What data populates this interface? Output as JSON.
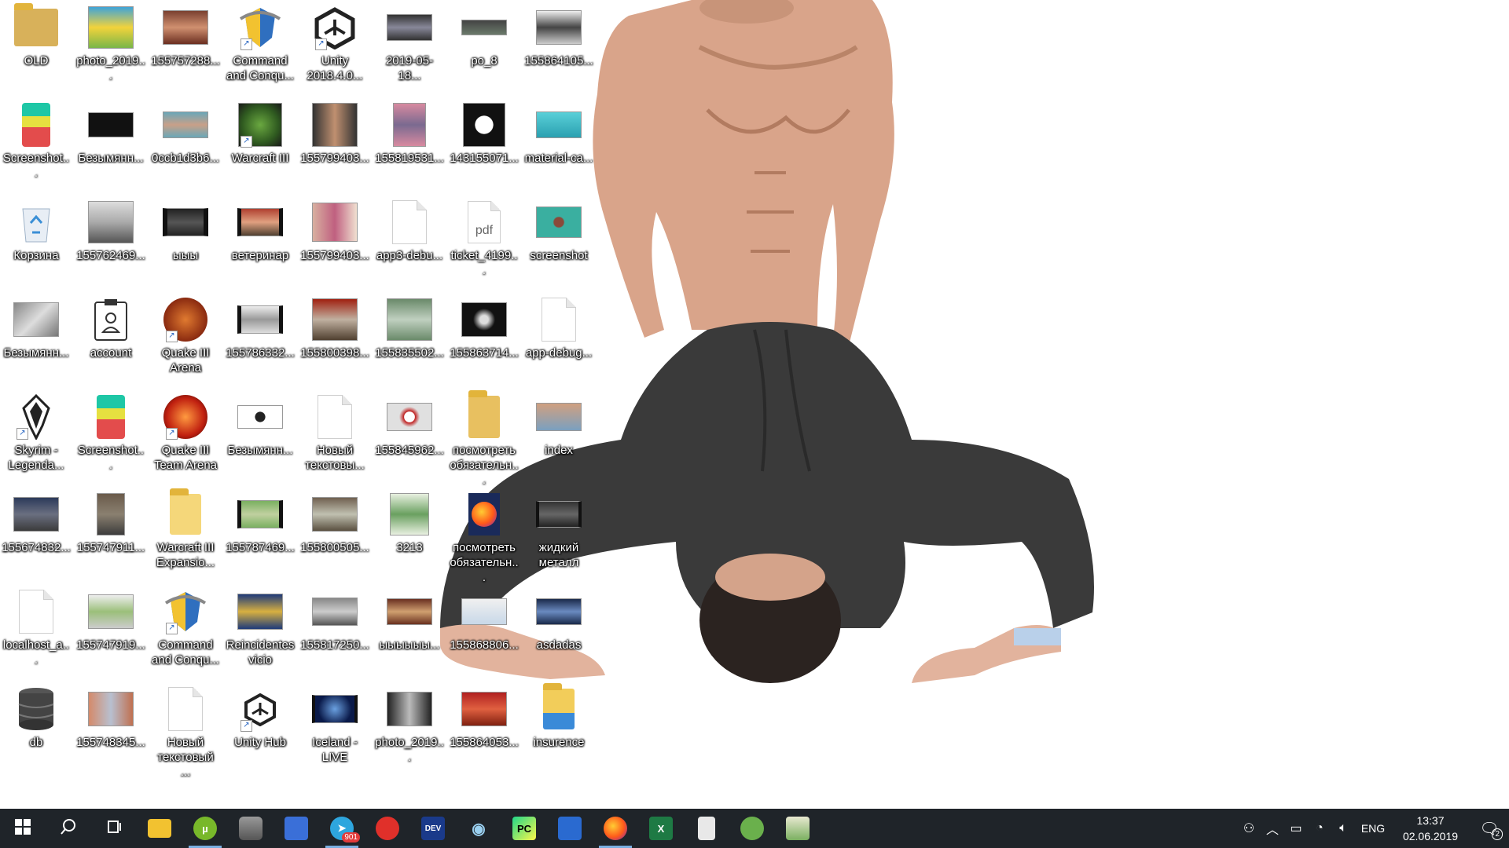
{
  "desktop": {
    "icons": [
      {
        "id": "c0r0",
        "label": "OLD"
      },
      {
        "id": "c1r0",
        "label": "photo_2019..."
      },
      {
        "id": "c2r0",
        "label": "155757288..."
      },
      {
        "id": "c3r0",
        "label": "Command and Conqu..."
      },
      {
        "id": "c4r0",
        "label": "Unity 2018.4.0..."
      },
      {
        "id": "c5r0",
        "label": "2019-05-18..."
      },
      {
        "id": "c6r0",
        "label": "po_8"
      },
      {
        "id": "c7r0",
        "label": "155864105..."
      },
      {
        "id": "c0r1",
        "label": "Screenshot..."
      },
      {
        "id": "c1r1",
        "label": "Безымянн..."
      },
      {
        "id": "c2r1",
        "label": "0ccb1d3b6..."
      },
      {
        "id": "c3r1",
        "label": "Warcraft III"
      },
      {
        "id": "c4r1",
        "label": "155799403..."
      },
      {
        "id": "c5r1",
        "label": "155819531..."
      },
      {
        "id": "c6r1",
        "label": "143155071..."
      },
      {
        "id": "c7r1",
        "label": "material-ca..."
      },
      {
        "id": "c0r2",
        "label": "Корзина"
      },
      {
        "id": "c1r2",
        "label": "155762469..."
      },
      {
        "id": "c2r2",
        "label": "ыыы"
      },
      {
        "id": "c3r2",
        "label": "ветеринар"
      },
      {
        "id": "c4r2",
        "label": "155799403..."
      },
      {
        "id": "c5r2",
        "label": "app3-debu..."
      },
      {
        "id": "c6r2",
        "label": "ticket_4199..."
      },
      {
        "id": "c7r2",
        "label": "screenshot"
      },
      {
        "id": "c0r3",
        "label": "Безымянн..."
      },
      {
        "id": "c1r3",
        "label": "account"
      },
      {
        "id": "c2r3",
        "label": "Quake III Arena"
      },
      {
        "id": "c3r3",
        "label": "155786332..."
      },
      {
        "id": "c4r3",
        "label": "155800398..."
      },
      {
        "id": "c5r3",
        "label": "155835502..."
      },
      {
        "id": "c6r3",
        "label": "155863714..."
      },
      {
        "id": "c7r3",
        "label": "app-debug..."
      },
      {
        "id": "c0r4",
        "label": "Skyrim - Legenda..."
      },
      {
        "id": "c1r4",
        "label": "Screenshot..."
      },
      {
        "id": "c2r4",
        "label": "Quake III Team Arena"
      },
      {
        "id": "c3r4",
        "label": "Безымянн..."
      },
      {
        "id": "c4r4",
        "label": "Новый текстовы..."
      },
      {
        "id": "c5r4",
        "label": "155845962..."
      },
      {
        "id": "c6r4",
        "label": "посмотреть обязательн..."
      },
      {
        "id": "c7r4",
        "label": "index"
      },
      {
        "id": "c0r5",
        "label": "155674832..."
      },
      {
        "id": "c1r5",
        "label": "155747911..."
      },
      {
        "id": "c2r5",
        "label": "Warcraft III Expansio..."
      },
      {
        "id": "c3r5",
        "label": "155787469..."
      },
      {
        "id": "c4r5",
        "label": "155800505..."
      },
      {
        "id": "c5r5",
        "label": "3213"
      },
      {
        "id": "c6r5",
        "label": "посмотреть обязательн..."
      },
      {
        "id": "c7r5",
        "label": "жидкий металл"
      },
      {
        "id": "c0r6",
        "label": "localhost_a..."
      },
      {
        "id": "c1r6",
        "label": "155747919..."
      },
      {
        "id": "c2r6",
        "label": "Command and Conqu..."
      },
      {
        "id": "c3r6",
        "label": "Reincidentes vicio"
      },
      {
        "id": "c4r6",
        "label": "155817250..."
      },
      {
        "id": "c5r6",
        "label": "ыыыыыы..."
      },
      {
        "id": "c6r6",
        "label": "155868806..."
      },
      {
        "id": "c7r6",
        "label": "asdadas"
      },
      {
        "id": "c0r7",
        "label": "db"
      },
      {
        "id": "c1r7",
        "label": "155748345..."
      },
      {
        "id": "c2r7",
        "label": "Новый текстовый ..."
      },
      {
        "id": "c3r7",
        "label": "Unity Hub"
      },
      {
        "id": "c4r7",
        "label": "Iceland - LIVE"
      },
      {
        "id": "c5r7",
        "label": "photo_2019..."
      },
      {
        "id": "c6r7",
        "label": "155864053..."
      },
      {
        "id": "c7r7",
        "label": "insurence"
      }
    ]
  },
  "taskbar": {
    "apps": [
      {
        "name": "start-button",
        "icon": "windows-icon"
      },
      {
        "name": "search-button",
        "icon": "search-icon"
      },
      {
        "name": "task-view-button",
        "icon": "task-view-icon"
      },
      {
        "name": "file-explorer",
        "icon": "folder-icon"
      },
      {
        "name": "utorrent",
        "icon": "utorrent-icon",
        "active": true
      },
      {
        "name": "database-app",
        "icon": "database-icon"
      },
      {
        "name": "network-app",
        "icon": "network-icon"
      },
      {
        "name": "telegram",
        "icon": "telegram-icon",
        "badge": "901",
        "active": true
      },
      {
        "name": "red-app",
        "icon": "red-circle-icon"
      },
      {
        "name": "devexpress",
        "icon": "dev-icon"
      },
      {
        "name": "eye-app",
        "icon": "eye-icon"
      },
      {
        "name": "pycharm",
        "icon": "pycharm-icon"
      },
      {
        "name": "windows-app",
        "icon": "windows-app-icon"
      },
      {
        "name": "firefox",
        "icon": "firefox-icon",
        "active": true
      },
      {
        "name": "excel",
        "icon": "excel-icon"
      },
      {
        "name": "notepad",
        "icon": "notepad-icon"
      },
      {
        "name": "android-studio",
        "icon": "android-icon"
      },
      {
        "name": "image-app",
        "icon": "image-icon"
      }
    ],
    "tray": {
      "language": "ENG",
      "time": "13:37",
      "date": "02.06.2019",
      "notifications": "2"
    },
    "colors": {
      "bg": "#1f2429",
      "active_underline": "#7aaee0"
    }
  }
}
